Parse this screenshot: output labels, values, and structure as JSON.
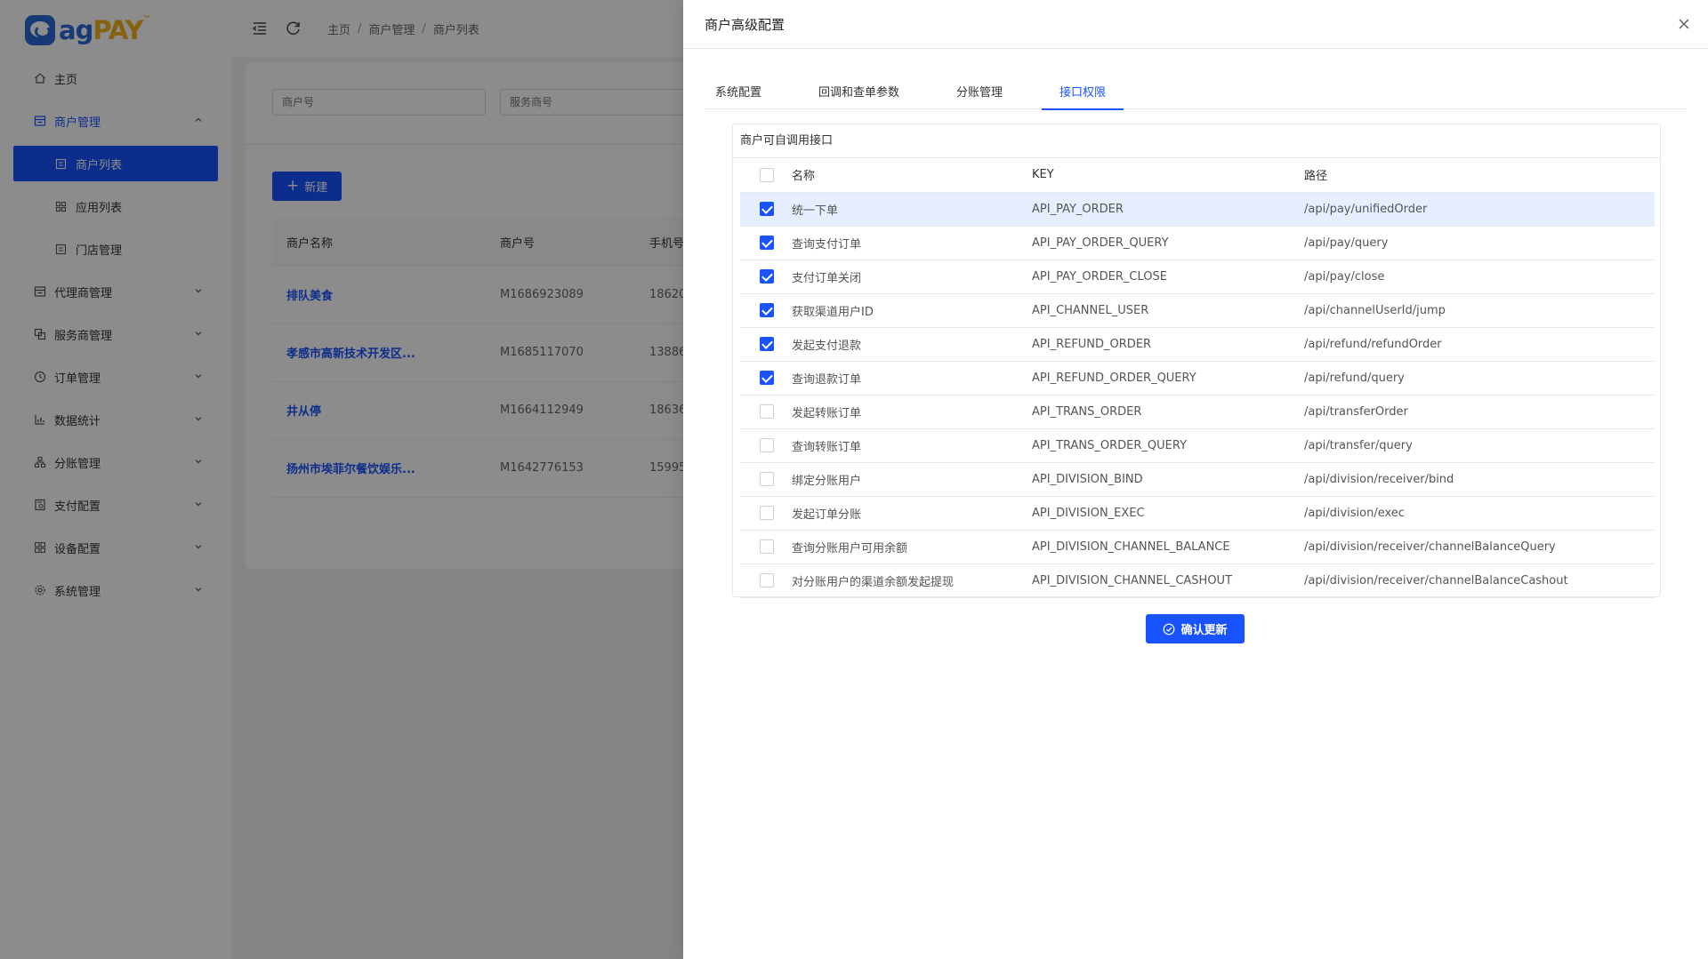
{
  "logo": {
    "ag": "ag",
    "pay": "PAY",
    "tm": "™"
  },
  "sidebar": {
    "items": [
      {
        "label": "主页",
        "icon": "home-icon"
      },
      {
        "label": "商户管理",
        "icon": "merchant-icon",
        "open": true,
        "children": [
          {
            "label": "商户列表",
            "active": true
          },
          {
            "label": "应用列表"
          },
          {
            "label": "门店管理"
          }
        ]
      },
      {
        "label": "代理商管理",
        "icon": "agent-icon"
      },
      {
        "label": "服务商管理",
        "icon": "service-provider-icon"
      },
      {
        "label": "订单管理",
        "icon": "order-icon"
      },
      {
        "label": "数据统计",
        "icon": "chart-icon"
      },
      {
        "label": "分账管理",
        "icon": "division-icon"
      },
      {
        "label": "支付配置",
        "icon": "pay-config-icon"
      },
      {
        "label": "设备配置",
        "icon": "device-icon"
      },
      {
        "label": "系统管理",
        "icon": "system-icon"
      }
    ]
  },
  "breadcrumb": [
    "主页",
    "商户管理",
    "商户列表"
  ],
  "search": {
    "merchant_no_placeholder": "商户号",
    "service_no_placeholder": "服务商号"
  },
  "new_button": "新建",
  "merchant_table": {
    "columns": [
      "商户名称",
      "商户号",
      "手机号"
    ],
    "rows": [
      {
        "name": "排队美食",
        "no": "M1686923089",
        "phone": "18620"
      },
      {
        "name": "孝感市高新技术开发区...",
        "no": "M1685117070",
        "phone": "13886"
      },
      {
        "name": "井从停",
        "no": "M1664112949",
        "phone": "18636"
      },
      {
        "name": "扬州市埃菲尔餐饮娱乐...",
        "no": "M1642776153",
        "phone": "15995"
      }
    ]
  },
  "drawer": {
    "title": "商户高级配置",
    "tabs": [
      {
        "label": "系统配置"
      },
      {
        "label": "回调和查单参数"
      },
      {
        "label": "分账管理"
      },
      {
        "label": "接口权限",
        "active": true
      }
    ],
    "panel_title": "商户可自调用接口",
    "table": {
      "headers": {
        "name": "名称",
        "key": "KEY",
        "path": "路径"
      },
      "header_checked": false,
      "rows": [
        {
          "checked": true,
          "name": "统一下单",
          "key": "API_PAY_ORDER",
          "path": "/api/pay/unifiedOrder"
        },
        {
          "checked": true,
          "name": "查询支付订单",
          "key": "API_PAY_ORDER_QUERY",
          "path": "/api/pay/query"
        },
        {
          "checked": true,
          "name": "支付订单关闭",
          "key": "API_PAY_ORDER_CLOSE",
          "path": "/api/pay/close"
        },
        {
          "checked": true,
          "name": "获取渠道用户ID",
          "key": "API_CHANNEL_USER",
          "path": "/api/channelUserId/jump"
        },
        {
          "checked": true,
          "name": "发起支付退款",
          "key": "API_REFUND_ORDER",
          "path": "/api/refund/refundOrder"
        },
        {
          "checked": true,
          "name": "查询退款订单",
          "key": "API_REFUND_ORDER_QUERY",
          "path": "/api/refund/query"
        },
        {
          "checked": false,
          "name": "发起转账订单",
          "key": "API_TRANS_ORDER",
          "path": "/api/transferOrder"
        },
        {
          "checked": false,
          "name": "查询转账订单",
          "key": "API_TRANS_ORDER_QUERY",
          "path": "/api/transfer/query"
        },
        {
          "checked": false,
          "name": "绑定分账用户",
          "key": "API_DIVISION_BIND",
          "path": "/api/division/receiver/bind"
        },
        {
          "checked": false,
          "name": "发起订单分账",
          "key": "API_DIVISION_EXEC",
          "path": "/api/division/exec"
        },
        {
          "checked": false,
          "name": "查询分账用户可用余额",
          "key": "API_DIVISION_CHANNEL_BALANCE",
          "path": "/api/division/receiver/channelBalanceQuery"
        },
        {
          "checked": false,
          "name": "对分账用户的渠道余额发起提现",
          "key": "API_DIVISION_CHANNEL_CASHOUT",
          "path": "/api/division/receiver/channelBalanceCashout"
        }
      ]
    },
    "confirm_button": "确认更新"
  },
  "colors": {
    "primary": "#1953ff",
    "highlight_row": "#e6efff",
    "logo_blue": "#2b6bd8",
    "logo_yellow": "#f6b31a"
  }
}
